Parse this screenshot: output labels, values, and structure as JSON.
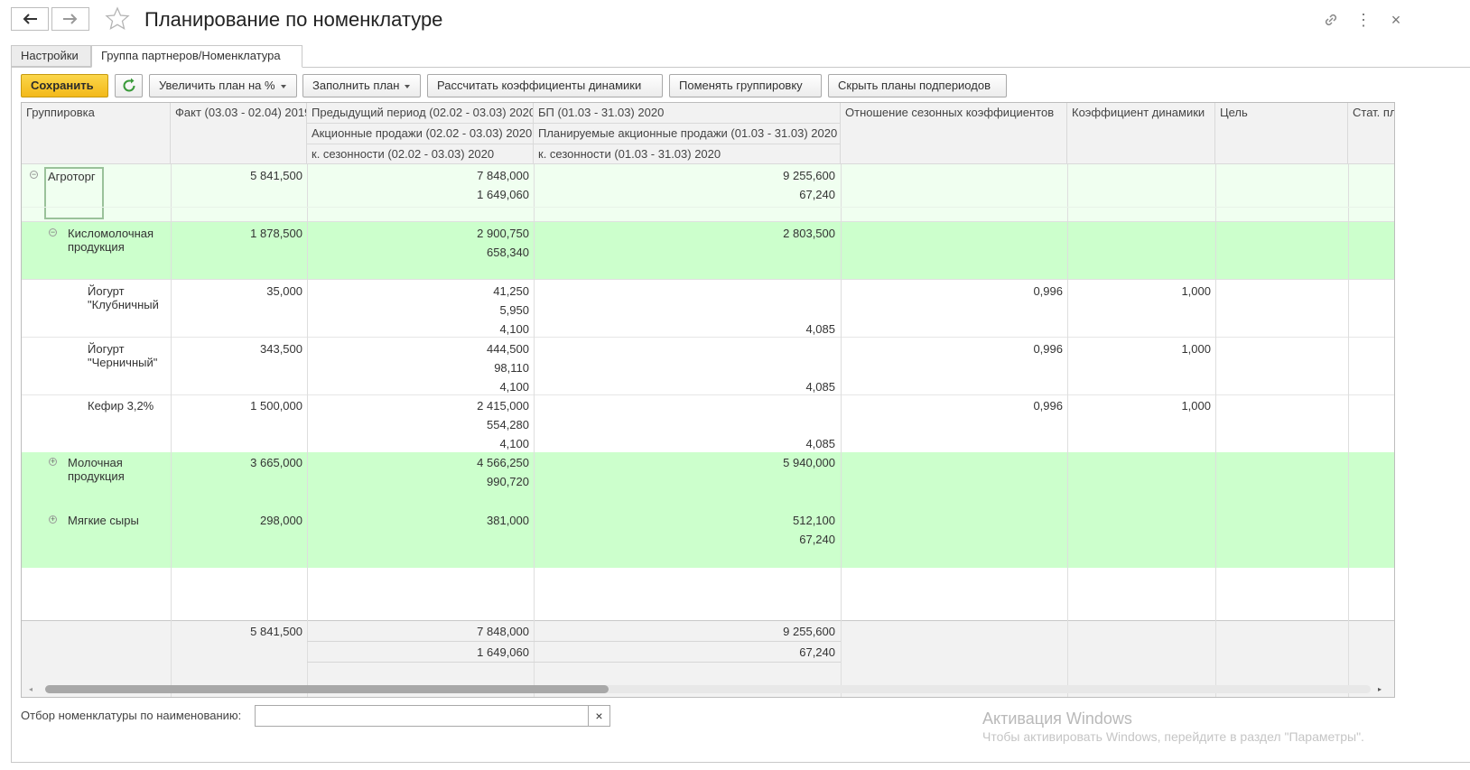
{
  "window": {
    "title": "Планирование по номенклатуре",
    "back_icon": "arrow-left-icon",
    "forward_icon": "arrow-right-icon",
    "favorite_icon": "star-icon",
    "link_icon": "link-icon",
    "more_icon": "more-vertical-icon",
    "close_icon": "close-icon",
    "close_glyph": "×",
    "more_glyph": "⋮"
  },
  "tabs": [
    {
      "label": "Настройки"
    },
    {
      "label": "Группа партнеров/Номенклатура"
    }
  ],
  "toolbar": {
    "save_label": "Сохранить",
    "refresh_icon": "refresh-icon",
    "increase_label": "Увеличить план на %",
    "fill_label": "Заполнить план",
    "calc_label": "Рассчитать коэффициенты динамики",
    "regroup_label": "Поменять группировку",
    "hide_label": "Скрыть планы подпериодов"
  },
  "table": {
    "headers": {
      "grouping": "Группировка",
      "fact": "Факт (03.03 - 02.04) 2019",
      "prev": "Предыдущий период (02.02 - 03.03) 2020",
      "prev_promo": "Акционные продажи (02.02 - 03.03) 2020",
      "prev_season": "к. сезонности (02.02 - 03.03) 2020",
      "bp": "БП (01.03 - 31.03) 2020",
      "bp_promo": "Планируемые акционные продажи (01.03 - 31.03) 2020",
      "bp_season": "к. сезонности (01.03 - 31.03) 2020",
      "season_ratio": "Отношение сезонных коэффициентов",
      "dynamics": "Коэффициент динамики",
      "target": "Цель",
      "stat": "Стат. пл"
    },
    "rows": [
      {
        "name": "Агроторг",
        "fact": "5 841,500",
        "prev": [
          "7 848,000",
          "1 649,060",
          ""
        ],
        "bp": [
          "9 255,600",
          "67,240",
          ""
        ],
        "ratio": "",
        "dyn": ""
      },
      {
        "name": "Кисломолочная продукция",
        "fact": "1 878,500",
        "prev": [
          "2 900,750",
          "658,340",
          ""
        ],
        "bp": [
          "2 803,500",
          "",
          ""
        ],
        "ratio": "",
        "dyn": ""
      },
      {
        "name": "Йогурт \"Клубничный",
        "fact": "35,000",
        "prev": [
          "41,250",
          "5,950",
          "4,100"
        ],
        "bp": [
          "",
          "",
          "4,085"
        ],
        "ratio": "0,996",
        "dyn": "1,000"
      },
      {
        "name": "Йогурт \"Черничный\"",
        "fact": "343,500",
        "prev": [
          "444,500",
          "98,110",
          "4,100"
        ],
        "bp": [
          "",
          "",
          "4,085"
        ],
        "ratio": "0,996",
        "dyn": "1,000"
      },
      {
        "name": "Кефир 3,2%",
        "fact": "1 500,000",
        "prev": [
          "2 415,000",
          "554,280",
          "4,100"
        ],
        "bp": [
          "",
          "",
          "4,085"
        ],
        "ratio": "0,996",
        "dyn": "1,000"
      },
      {
        "name": "Молочная продукция",
        "fact": "3 665,000",
        "prev": [
          "4 566,250",
          "990,720",
          ""
        ],
        "bp": [
          "5 940,000",
          "",
          ""
        ],
        "ratio": "",
        "dyn": ""
      },
      {
        "name": "Мягкие сыры",
        "fact": "298,000",
        "prev": [
          "381,000",
          "",
          ""
        ],
        "bp": [
          "512,100",
          "67,240",
          ""
        ],
        "ratio": "",
        "dyn": ""
      }
    ],
    "totals": {
      "fact": "5 841,500",
      "prev": [
        "7 848,000",
        "1 649,060"
      ],
      "bp": [
        "9 255,600",
        "67,240"
      ]
    }
  },
  "filter": {
    "label": "Отбор номенклатуры по наименованию:",
    "value": "",
    "clear_glyph": "×"
  },
  "watermark": {
    "line1": "Активация Windows",
    "line2": "Чтобы активировать Windows, перейдите в раздел \"Параметры\"."
  },
  "colors": {
    "group_row": "#ccffcc",
    "top_group_row": "#f0fff0",
    "save_button": "#f5c31f",
    "refresh_icon": "#3a9a3a"
  }
}
